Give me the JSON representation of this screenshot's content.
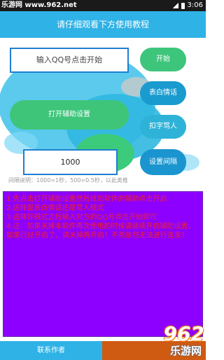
{
  "status_bar": {
    "site_tag": "乐游网 www.962.net",
    "time": "3:06"
  },
  "header": {
    "title": "请仔细观看下方使用教程"
  },
  "inputs": {
    "qq_placeholder": "输入QQ号点击开始",
    "interval_value": "1000"
  },
  "buttons": {
    "start": "开始",
    "confess": "表白情话",
    "curse": "扣字骂人",
    "interval": "设置间隔",
    "accessibility": "打开辅助设置"
  },
  "interval_note": "间隔说明：1000=1秒，500=0.5秒，以此类推",
  "instructions": [
    "1.先点击打开辅助设置然后找到软件的辅助点击开启",
    "2.选择是表白情话还是骂人模式",
    "3.选择好模式之后输入对方的QQ号点击开始即可",
    " 4.注：如果关掉本软件再次使用的时候请继续开启辅助设置，如果已经开启了，请关掉再开启！不然依然无法进行连发！"
  ],
  "bottom": {
    "contact": "联系作者"
  },
  "watermark": {
    "brand": "962",
    "sub": "乐游网"
  },
  "colors": {
    "header": "#2fb2e6",
    "instructions_bg": "#8d00ff",
    "instructions_text": "#f0212a"
  }
}
